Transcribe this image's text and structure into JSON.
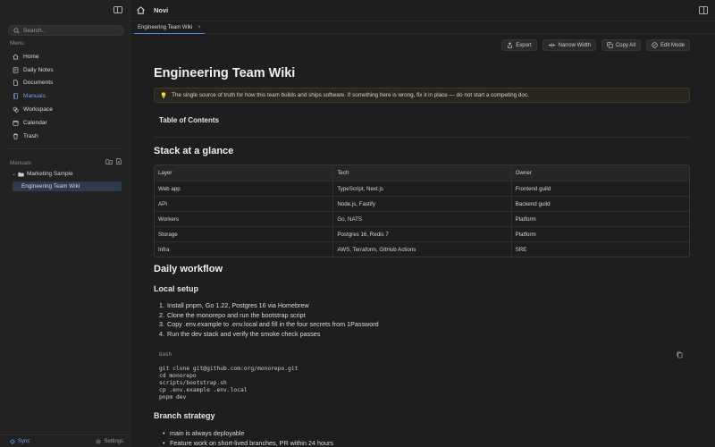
{
  "sidebar": {
    "search_placeholder": "Search...",
    "menu_label": "Menu",
    "items": [
      {
        "label": "Home",
        "icon": "home-icon"
      },
      {
        "label": "Daily Notes",
        "icon": "daily-notes-icon"
      },
      {
        "label": "Documents",
        "icon": "documents-icon"
      },
      {
        "label": "Manuals",
        "icon": "manuals-icon",
        "active": true
      },
      {
        "label": "Workspace",
        "icon": "workspace-icon"
      },
      {
        "label": "Calendar",
        "icon": "calendar-icon"
      },
      {
        "label": "Trash",
        "icon": "trash-icon"
      }
    ],
    "manuals_label": "Manuals",
    "tree": {
      "folder": "Marketing Sample",
      "selected_doc": "Engineering Team Wiki"
    },
    "sync_label": "Sync",
    "settings_label": "Settings"
  },
  "topbar": {
    "title": "Novi"
  },
  "tab": {
    "label": "Engineering Team Wiki",
    "close": "×"
  },
  "toolbar": {
    "export": "Export",
    "narrow_width": "Narrow Width",
    "copy_all": "Copy All",
    "edit_mode": "Edit Mode"
  },
  "doc": {
    "title": "Engineering Team Wiki",
    "callout": "The single source of truth for how this team builds and ships software. If something here is wrong, fix it in place — do not start a competing doc.",
    "toc": "Table of Contents",
    "stack_heading": "Stack at a glance",
    "table": {
      "headers": [
        "Layer",
        "Tech",
        "Owner"
      ],
      "rows": [
        [
          "Web app",
          "TypeScript, Next.js",
          "Frontend guild"
        ],
        [
          "API",
          "Node.js, Fastify",
          "Backend guild"
        ],
        [
          "Workers",
          "Go, NATS",
          "Platform"
        ],
        [
          "Storage",
          "Postgres 16, Redis 7",
          "Platform"
        ],
        [
          "Infra",
          "AWS, Terraform, GitHub Actions",
          "SRE"
        ]
      ]
    },
    "workflow_heading": "Daily workflow",
    "local_setup_heading": "Local setup",
    "steps": [
      "Install pnpm, Go 1.22, Postgres 16 via Homebrew",
      "Clone the monorepo and run the bootstrap script",
      "Copy .env.example to .env.local and fill in the four secrets from 1Password",
      "Run the dev stack and verify the smoke check passes"
    ],
    "code": {
      "lang": "bash",
      "lines": [
        "git clone git@github.com:org/monorepo.git",
        "cd monorepo",
        "scripts/bootstrap.sh",
        "cp .env.example .env.local",
        "pnpm dev"
      ]
    },
    "branch_heading": "Branch strategy",
    "branch_items": [
      "main is always deployable",
      "Feature work on short-lived branches, PR within 24 hours"
    ]
  },
  "colors": {
    "accent": "#6fa3f4",
    "tab_underline": "#4a8ee8",
    "background": "#1e1e1e"
  }
}
